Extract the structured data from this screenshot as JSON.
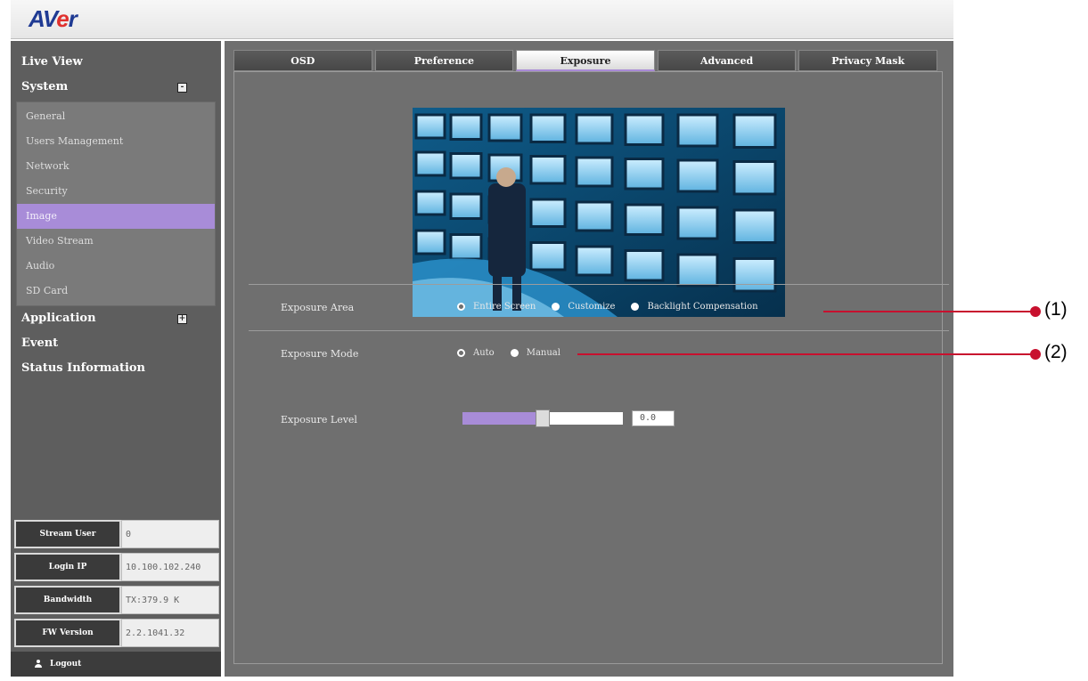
{
  "header": {
    "logo": "AVer"
  },
  "sidebar": {
    "sections": [
      {
        "label": "Live View"
      },
      {
        "label": "System",
        "toggle": "-"
      },
      {
        "label": "Application",
        "toggle": "+"
      },
      {
        "label": "Event"
      },
      {
        "label": "Status Information"
      }
    ],
    "system_items": [
      {
        "label": "General"
      },
      {
        "label": "Users Management"
      },
      {
        "label": "Network"
      },
      {
        "label": "Security"
      },
      {
        "label": "Image",
        "active": true
      },
      {
        "label": "Video Stream"
      },
      {
        "label": "Audio"
      },
      {
        "label": "SD Card"
      }
    ],
    "info": [
      {
        "label": "Stream User",
        "value": "0"
      },
      {
        "label": "Login IP",
        "value": "10.100.102.240"
      },
      {
        "label": "Bandwidth",
        "value": "TX:379.9 K"
      },
      {
        "label": "FW Version",
        "value": "2.2.1041.32"
      }
    ],
    "logout_label": "Logout"
  },
  "tabs": [
    {
      "label": "OSD"
    },
    {
      "label": "Preference"
    },
    {
      "label": "Exposure",
      "active": true
    },
    {
      "label": "Advanced"
    },
    {
      "label": "Privacy Mask"
    }
  ],
  "exposure": {
    "area_label": "Exposure Area",
    "area_options": [
      {
        "label": "Entire Screen",
        "selected": true
      },
      {
        "label": "Customize",
        "selected": false
      },
      {
        "label": "Backlight Compensation",
        "selected": false
      }
    ],
    "mode_label": "Exposure Mode",
    "mode_options": [
      {
        "label": "Auto",
        "selected": true
      },
      {
        "label": "Manual",
        "selected": false
      }
    ],
    "level_label": "Exposure Level",
    "level_value": "0.0",
    "level_fraction": 0.5
  },
  "callouts": {
    "one": "(1)",
    "two": "(2)"
  },
  "colors": {
    "accent": "#a88cd8",
    "callout": "#c8102e",
    "sidebar": "#5e5e5e",
    "panel": "#6f6f6f"
  }
}
